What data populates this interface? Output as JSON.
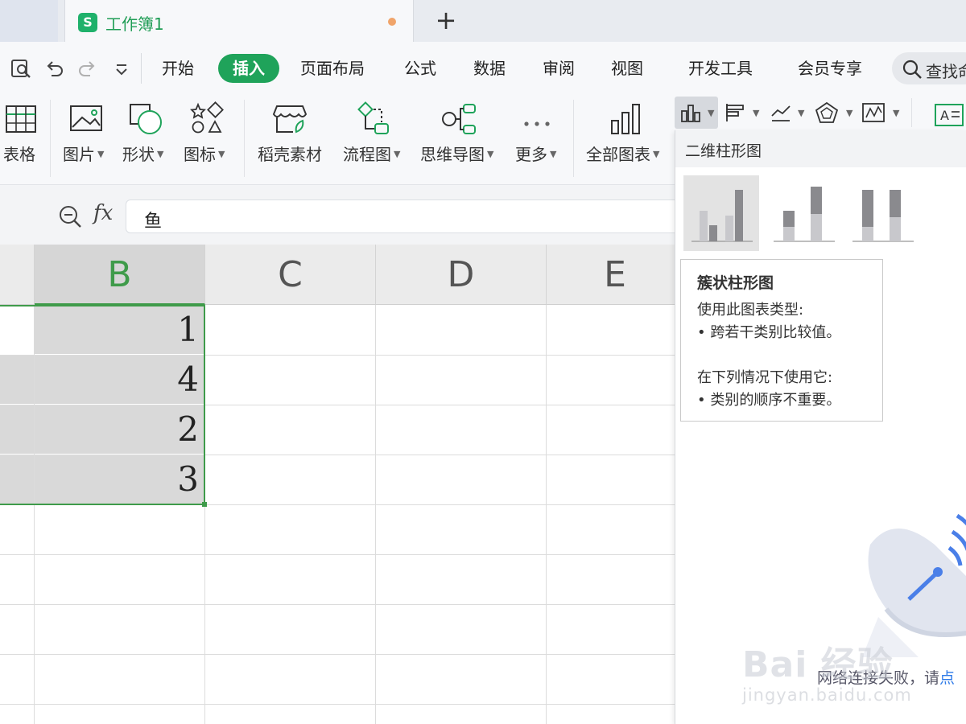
{
  "tab": {
    "title": "工作簿1",
    "icon_letter": "S",
    "new_tab": "+"
  },
  "menu": {
    "items": [
      "开始",
      "插入",
      "页面布局",
      "公式",
      "数据",
      "审阅",
      "视图",
      "开发工具",
      "会员专享"
    ],
    "active": "插入",
    "search_placeholder": "查找命"
  },
  "ribbon": {
    "buttons": [
      "表格",
      "图片",
      "形状",
      "图标",
      "稻壳素材",
      "流程图",
      "思维导图",
      "更多",
      "全部图表"
    ],
    "accent": "#1fa35a"
  },
  "formula": {
    "fx_label": "fx",
    "value": "鱼"
  },
  "grid": {
    "columns": [
      "B",
      "C",
      "D",
      "E"
    ],
    "active_column": "B",
    "values": [
      "1",
      "4",
      "2",
      "3"
    ],
    "selection_color": "#3f9b4a"
  },
  "panel": {
    "title": "二维柱形图",
    "tooltip": {
      "title": "簇状柱形图",
      "line1": "使用此图表类型:",
      "line2": "• 跨若干类别比较值。",
      "line3": "在下列情况下使用它:",
      "line4": "• 类别的顺序不重要。"
    },
    "net_message": "网络连接失败，请",
    "net_link": "点"
  },
  "watermark": {
    "main": "Bai 经验",
    "sub": "jingyan.baidu.com"
  }
}
